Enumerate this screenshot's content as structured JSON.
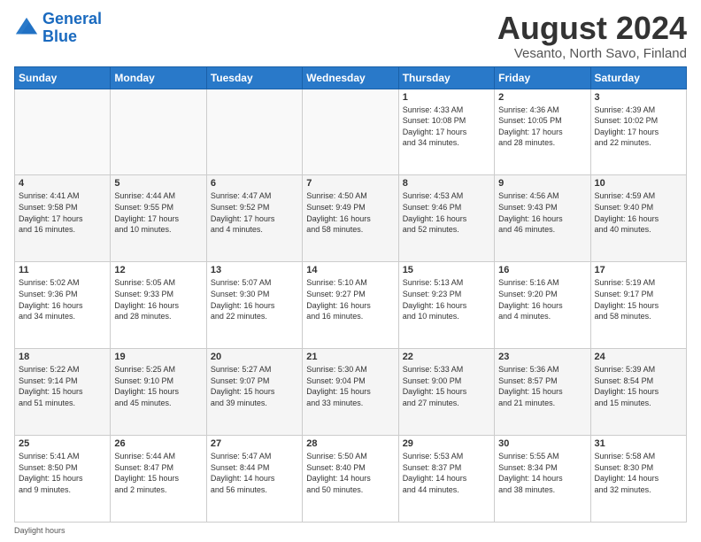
{
  "header": {
    "logo_line1": "General",
    "logo_line2": "Blue",
    "main_title": "August 2024",
    "subtitle": "Vesanto, North Savo, Finland"
  },
  "footer": {
    "daylight_label": "Daylight hours"
  },
  "days_of_week": [
    "Sunday",
    "Monday",
    "Tuesday",
    "Wednesday",
    "Thursday",
    "Friday",
    "Saturday"
  ],
  "weeks": [
    [
      {
        "num": "",
        "info": ""
      },
      {
        "num": "",
        "info": ""
      },
      {
        "num": "",
        "info": ""
      },
      {
        "num": "",
        "info": ""
      },
      {
        "num": "1",
        "info": "Sunrise: 4:33 AM\nSunset: 10:08 PM\nDaylight: 17 hours\nand 34 minutes."
      },
      {
        "num": "2",
        "info": "Sunrise: 4:36 AM\nSunset: 10:05 PM\nDaylight: 17 hours\nand 28 minutes."
      },
      {
        "num": "3",
        "info": "Sunrise: 4:39 AM\nSunset: 10:02 PM\nDaylight: 17 hours\nand 22 minutes."
      }
    ],
    [
      {
        "num": "4",
        "info": "Sunrise: 4:41 AM\nSunset: 9:58 PM\nDaylight: 17 hours\nand 16 minutes."
      },
      {
        "num": "5",
        "info": "Sunrise: 4:44 AM\nSunset: 9:55 PM\nDaylight: 17 hours\nand 10 minutes."
      },
      {
        "num": "6",
        "info": "Sunrise: 4:47 AM\nSunset: 9:52 PM\nDaylight: 17 hours\nand 4 minutes."
      },
      {
        "num": "7",
        "info": "Sunrise: 4:50 AM\nSunset: 9:49 PM\nDaylight: 16 hours\nand 58 minutes."
      },
      {
        "num": "8",
        "info": "Sunrise: 4:53 AM\nSunset: 9:46 PM\nDaylight: 16 hours\nand 52 minutes."
      },
      {
        "num": "9",
        "info": "Sunrise: 4:56 AM\nSunset: 9:43 PM\nDaylight: 16 hours\nand 46 minutes."
      },
      {
        "num": "10",
        "info": "Sunrise: 4:59 AM\nSunset: 9:40 PM\nDaylight: 16 hours\nand 40 minutes."
      }
    ],
    [
      {
        "num": "11",
        "info": "Sunrise: 5:02 AM\nSunset: 9:36 PM\nDaylight: 16 hours\nand 34 minutes."
      },
      {
        "num": "12",
        "info": "Sunrise: 5:05 AM\nSunset: 9:33 PM\nDaylight: 16 hours\nand 28 minutes."
      },
      {
        "num": "13",
        "info": "Sunrise: 5:07 AM\nSunset: 9:30 PM\nDaylight: 16 hours\nand 22 minutes."
      },
      {
        "num": "14",
        "info": "Sunrise: 5:10 AM\nSunset: 9:27 PM\nDaylight: 16 hours\nand 16 minutes."
      },
      {
        "num": "15",
        "info": "Sunrise: 5:13 AM\nSunset: 9:23 PM\nDaylight: 16 hours\nand 10 minutes."
      },
      {
        "num": "16",
        "info": "Sunrise: 5:16 AM\nSunset: 9:20 PM\nDaylight: 16 hours\nand 4 minutes."
      },
      {
        "num": "17",
        "info": "Sunrise: 5:19 AM\nSunset: 9:17 PM\nDaylight: 15 hours\nand 58 minutes."
      }
    ],
    [
      {
        "num": "18",
        "info": "Sunrise: 5:22 AM\nSunset: 9:14 PM\nDaylight: 15 hours\nand 51 minutes."
      },
      {
        "num": "19",
        "info": "Sunrise: 5:25 AM\nSunset: 9:10 PM\nDaylight: 15 hours\nand 45 minutes."
      },
      {
        "num": "20",
        "info": "Sunrise: 5:27 AM\nSunset: 9:07 PM\nDaylight: 15 hours\nand 39 minutes."
      },
      {
        "num": "21",
        "info": "Sunrise: 5:30 AM\nSunset: 9:04 PM\nDaylight: 15 hours\nand 33 minutes."
      },
      {
        "num": "22",
        "info": "Sunrise: 5:33 AM\nSunset: 9:00 PM\nDaylight: 15 hours\nand 27 minutes."
      },
      {
        "num": "23",
        "info": "Sunrise: 5:36 AM\nSunset: 8:57 PM\nDaylight: 15 hours\nand 21 minutes."
      },
      {
        "num": "24",
        "info": "Sunrise: 5:39 AM\nSunset: 8:54 PM\nDaylight: 15 hours\nand 15 minutes."
      }
    ],
    [
      {
        "num": "25",
        "info": "Sunrise: 5:41 AM\nSunset: 8:50 PM\nDaylight: 15 hours\nand 9 minutes."
      },
      {
        "num": "26",
        "info": "Sunrise: 5:44 AM\nSunset: 8:47 PM\nDaylight: 15 hours\nand 2 minutes."
      },
      {
        "num": "27",
        "info": "Sunrise: 5:47 AM\nSunset: 8:44 PM\nDaylight: 14 hours\nand 56 minutes."
      },
      {
        "num": "28",
        "info": "Sunrise: 5:50 AM\nSunset: 8:40 PM\nDaylight: 14 hours\nand 50 minutes."
      },
      {
        "num": "29",
        "info": "Sunrise: 5:53 AM\nSunset: 8:37 PM\nDaylight: 14 hours\nand 44 minutes."
      },
      {
        "num": "30",
        "info": "Sunrise: 5:55 AM\nSunset: 8:34 PM\nDaylight: 14 hours\nand 38 minutes."
      },
      {
        "num": "31",
        "info": "Sunrise: 5:58 AM\nSunset: 8:30 PM\nDaylight: 14 hours\nand 32 minutes."
      }
    ]
  ]
}
